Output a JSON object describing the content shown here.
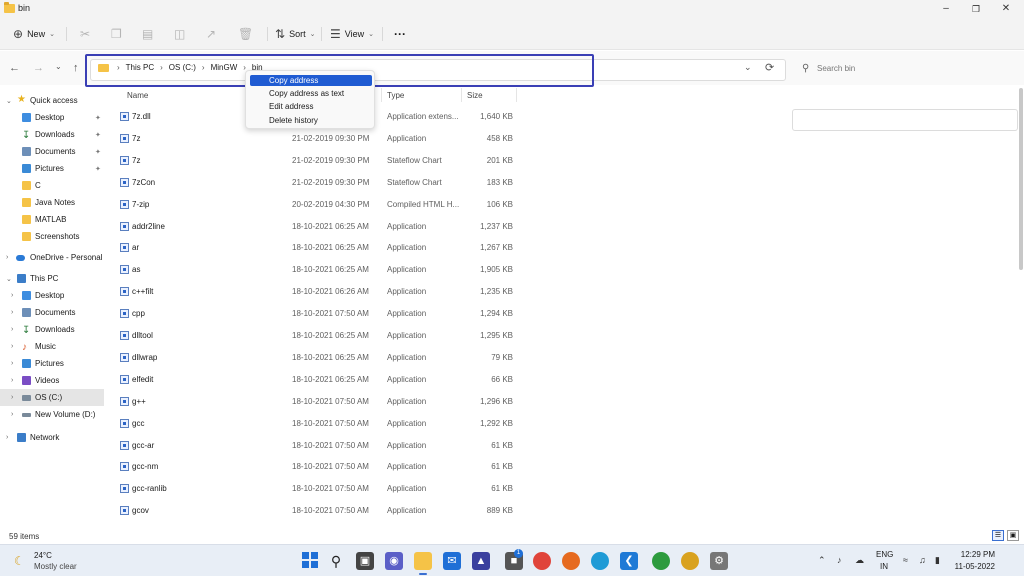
{
  "window": {
    "title": "bin"
  },
  "toolbar": {
    "new_label": "New",
    "sort_label": "Sort",
    "view_label": "View",
    "more_label": "···"
  },
  "address": {
    "crumbs": [
      "This PC",
      "OS (C:)",
      "MinGW",
      "bin"
    ]
  },
  "search": {
    "placeholder": "Search bin"
  },
  "context_menu": {
    "items": [
      "Copy address",
      "Copy address as text",
      "Edit address",
      "Delete history"
    ],
    "highlighted": "Copy address"
  },
  "columns": {
    "name": "Name",
    "type": "Type",
    "size": "Size"
  },
  "nav": {
    "quick_access": "Quick access",
    "desktop": "Desktop",
    "downloads": "Downloads",
    "documents": "Documents",
    "pictures": "Pictures",
    "c": "C",
    "java_notes": "Java Notes",
    "matlab": "MATLAB",
    "screenshots": "Screenshots",
    "onedrive": "OneDrive - Personal",
    "this_pc": "This PC",
    "pc_desktop": "Desktop",
    "pc_documents": "Documents",
    "pc_downloads": "Downloads",
    "music": "Music",
    "pc_pictures": "Pictures",
    "videos": "Videos",
    "os_c": "OS (C:)",
    "new_volume": "New Volume (D:)",
    "network": "Network"
  },
  "files": [
    {
      "name": "7z.dll",
      "date": "",
      "type": "Application extens...",
      "size": "1,640 KB"
    },
    {
      "name": "7z",
      "date": "21-02-2019 09:30 PM",
      "type": "Application",
      "size": "458 KB"
    },
    {
      "name": "7z",
      "date": "21-02-2019 09:30 PM",
      "type": "Stateflow Chart",
      "size": "201 KB"
    },
    {
      "name": "7zCon",
      "date": "21-02-2019 09:30 PM",
      "type": "Stateflow Chart",
      "size": "183 KB"
    },
    {
      "name": "7-zip",
      "date": "20-02-2019 04:30 PM",
      "type": "Compiled HTML H...",
      "size": "106 KB"
    },
    {
      "name": "addr2line",
      "date": "18-10-2021 06:25 AM",
      "type": "Application",
      "size": "1,237 KB"
    },
    {
      "name": "ar",
      "date": "18-10-2021 06:25 AM",
      "type": "Application",
      "size": "1,267 KB"
    },
    {
      "name": "as",
      "date": "18-10-2021 06:25 AM",
      "type": "Application",
      "size": "1,905 KB"
    },
    {
      "name": "c++filt",
      "date": "18-10-2021 06:26 AM",
      "type": "Application",
      "size": "1,235 KB"
    },
    {
      "name": "cpp",
      "date": "18-10-2021 07:50 AM",
      "type": "Application",
      "size": "1,294 KB"
    },
    {
      "name": "dlltool",
      "date": "18-10-2021 06:25 AM",
      "type": "Application",
      "size": "1,295 KB"
    },
    {
      "name": "dllwrap",
      "date": "18-10-2021 06:25 AM",
      "type": "Application",
      "size": "79 KB"
    },
    {
      "name": "elfedit",
      "date": "18-10-2021 06:25 AM",
      "type": "Application",
      "size": "66 KB"
    },
    {
      "name": "g++",
      "date": "18-10-2021 07:50 AM",
      "type": "Application",
      "size": "1,296 KB"
    },
    {
      "name": "gcc",
      "date": "18-10-2021 07:50 AM",
      "type": "Application",
      "size": "1,292 KB"
    },
    {
      "name": "gcc-ar",
      "date": "18-10-2021 07:50 AM",
      "type": "Application",
      "size": "61 KB"
    },
    {
      "name": "gcc-nm",
      "date": "18-10-2021 07:50 AM",
      "type": "Application",
      "size": "61 KB"
    },
    {
      "name": "gcc-ranlib",
      "date": "18-10-2021 07:50 AM",
      "type": "Application",
      "size": "61 KB"
    },
    {
      "name": "gcov",
      "date": "18-10-2021 07:50 AM",
      "type": "Application",
      "size": "889 KB"
    }
  ],
  "status": {
    "item_count": "59 items"
  },
  "taskbar": {
    "temperature": "24°C",
    "condition": "Mostly clear",
    "lang_line1": "ENG",
    "lang_line2": "IN",
    "time": "12:29 PM",
    "date": "11-05-2022",
    "badge_count": "1"
  },
  "colors": {
    "accent": "#1f5bd2",
    "highlight_border": "#3a3fb5",
    "folder": "#f5c347"
  }
}
